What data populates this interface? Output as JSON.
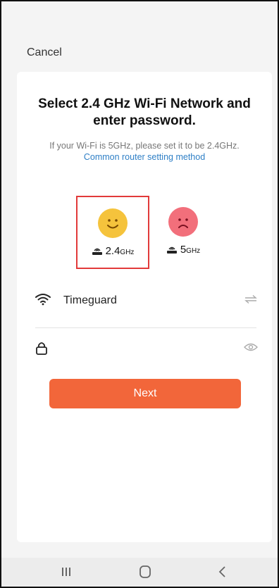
{
  "header": {
    "cancel_label": "Cancel"
  },
  "main": {
    "title": "Select 2.4 GHz Wi-Fi Network and enter password.",
    "hint": "If your Wi-Fi is 5GHz, please set it to be 2.4GHz.",
    "link": "Common router setting method"
  },
  "bands": [
    {
      "value": "2.4",
      "unit": "GHz",
      "face": "happy",
      "selected": true,
      "color": "#f5c33c"
    },
    {
      "value": "5",
      "unit": "GHz",
      "face": "sad",
      "selected": false,
      "color": "#f26f7b"
    }
  ],
  "wifi": {
    "ssid": "Timeguard",
    "password_value": ""
  },
  "actions": {
    "next_label": "Next"
  },
  "colors": {
    "accent": "#f2663a",
    "link": "#2e7fc6",
    "selection_border": "#e23a3a"
  },
  "icons": {
    "wifi": "wifi-icon",
    "lock": "lock-icon",
    "swap": "swap-icon",
    "eye": "eye-icon",
    "router": "router-icon",
    "recents": "recents-icon",
    "home": "home-icon",
    "back": "back-icon"
  }
}
